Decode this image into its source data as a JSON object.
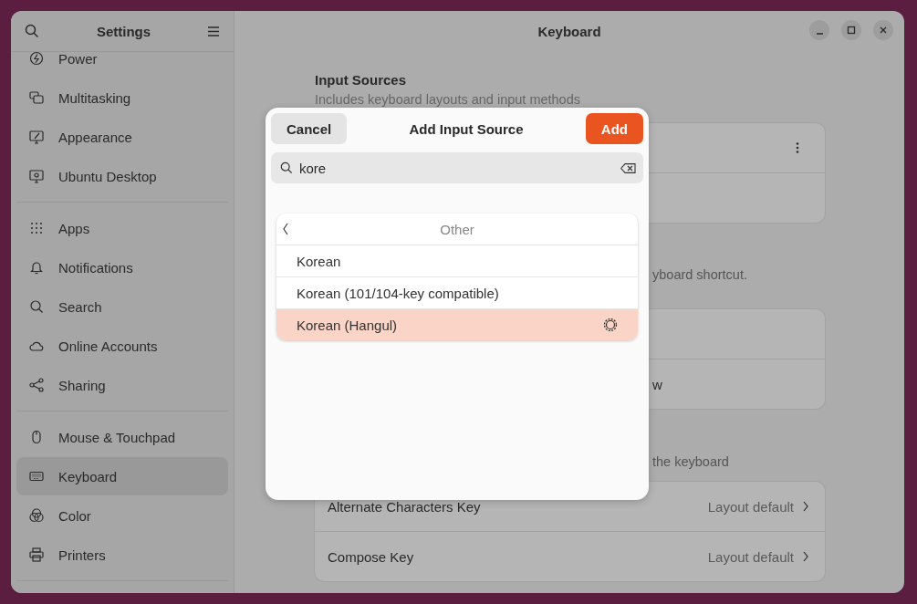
{
  "window": {
    "title": "Keyboard"
  },
  "sidebar": {
    "title": "Settings",
    "groups": [
      {
        "items": [
          {
            "label": "Power",
            "selected": false
          },
          {
            "label": "Multitasking",
            "selected": false
          },
          {
            "label": "Appearance",
            "selected": false
          },
          {
            "label": "Ubuntu Desktop",
            "selected": false
          }
        ]
      },
      {
        "items": [
          {
            "label": "Apps",
            "selected": false
          },
          {
            "label": "Notifications",
            "selected": false
          },
          {
            "label": "Search",
            "selected": false
          },
          {
            "label": "Online Accounts",
            "selected": false
          },
          {
            "label": "Sharing",
            "selected": false
          }
        ]
      },
      {
        "items": [
          {
            "label": "Mouse & Touchpad",
            "selected": false
          },
          {
            "label": "Keyboard",
            "selected": true
          },
          {
            "label": "Color",
            "selected": false
          },
          {
            "label": "Printers",
            "selected": false
          }
        ]
      }
    ]
  },
  "input_sources": {
    "heading": "Input Sources",
    "description": "Includes keyboard layouts and input methods"
  },
  "switching": {
    "description": "yboard shortcut.",
    "rows": [
      {
        "label": "w"
      }
    ]
  },
  "special_keys": {
    "description": "the keyboard",
    "rows": [
      {
        "label": "Alternate Characters Key",
        "value": "Layout default"
      },
      {
        "label": "Compose Key",
        "value": "Layout default"
      }
    ]
  },
  "dialog": {
    "title": "Add Input Source",
    "cancel": "Cancel",
    "add": "Add",
    "search": {
      "value": "kore"
    },
    "list": {
      "header": "Other",
      "items": [
        {
          "label": "Korean",
          "selected": false,
          "has_settings": false
        },
        {
          "label": "Korean (101/104-key compatible)",
          "selected": false,
          "has_settings": false
        },
        {
          "label": "Korean (Hangul)",
          "selected": true,
          "has_settings": true
        }
      ]
    }
  }
}
